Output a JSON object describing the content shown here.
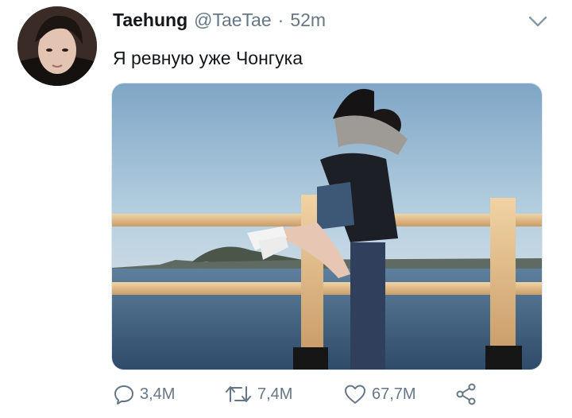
{
  "tweet": {
    "author_name": "Taehung",
    "author_handle": "@TaeTae",
    "separator": "·",
    "time": "52m",
    "text": "Я ревную уже Чонгука",
    "avatar_icon": "profile-photo",
    "menu_icon": "chevron-down-icon"
  },
  "actions": {
    "reply_count": "3,4M",
    "retweet_count": "7,4M",
    "like_count": "67,7M",
    "reply_icon": "comment-icon",
    "retweet_icon": "retweet-icon",
    "like_icon": "heart-icon",
    "share_icon": "share-icon"
  },
  "colors": {
    "primary_text": "#14171a",
    "secondary_text": "#657786",
    "icon_gray": "#657786"
  }
}
